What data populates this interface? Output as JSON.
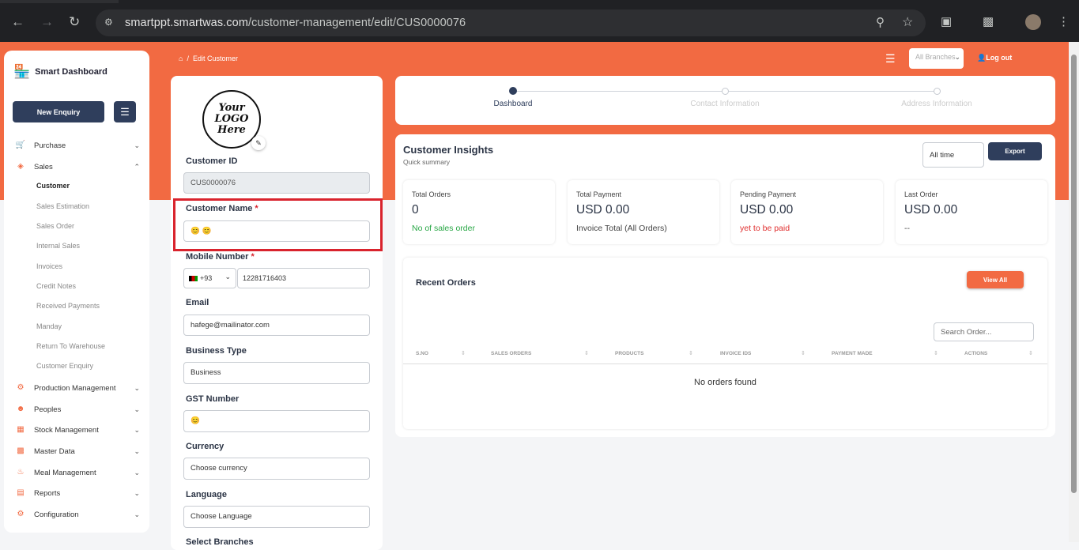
{
  "browser": {
    "url_host": "smartppt.smartwas.com",
    "url_path": "/customer-management/edit/CUS0000076"
  },
  "sidebar": {
    "brand": "Smart Dashboard",
    "new_enquiry": "New Enquiry",
    "items": [
      {
        "label": "Purchase",
        "icon": "cart-icon"
      },
      {
        "label": "Sales",
        "icon": "tag-icon"
      },
      {
        "label": "Production Management",
        "icon": "factory-icon"
      },
      {
        "label": "Peoples",
        "icon": "people-icon"
      },
      {
        "label": "Stock Management",
        "icon": "stock-icon"
      },
      {
        "label": "Master Data",
        "icon": "database-icon"
      },
      {
        "label": "Meal Management",
        "icon": "meal-icon"
      },
      {
        "label": "Reports",
        "icon": "report-icon"
      },
      {
        "label": "Configuration",
        "icon": "config-icon"
      }
    ],
    "sales_sub": [
      "Customer",
      "Sales Estimation",
      "Sales Order",
      "Internal Sales",
      "Invoices",
      "Credit Notes",
      "Received Payments",
      "Manday",
      "Return To Warehouse",
      "Customer Enquiry"
    ]
  },
  "header": {
    "breadcrumb": "Edit Customer",
    "branch_placeholder": "All Branches",
    "logout": "Log out"
  },
  "form": {
    "logo_text": "Your LOGO Here",
    "customer_id_label": "Customer ID",
    "customer_id_value": "CUS0000076",
    "customer_name_label": "Customer Name",
    "customer_name_value": "😊 😊",
    "mobile_label": "Mobile Number",
    "country_code": "+93",
    "mobile_value": "12281716403",
    "email_label": "Email",
    "email_value": "hafege@mailinator.com",
    "business_type_label": "Business Type",
    "business_type_value": "Business",
    "gst_label": "GST Number",
    "gst_value": "😊",
    "currency_label": "Currency",
    "currency_value": "Choose currency",
    "language_label": "Language",
    "language_value": "Choose Language",
    "branches_label": "Select Branches",
    "required_mark": "*"
  },
  "steps": [
    "Dashboard",
    "Contact Information",
    "Address Information"
  ],
  "insights": {
    "title": "Customer Insights",
    "subtitle": "Quick summary",
    "period": "All time",
    "export": "Export",
    "stats": [
      {
        "title": "Total Orders",
        "value": "0",
        "sub": "No of sales order",
        "sub_color": "#28a745"
      },
      {
        "title": "Total Payment",
        "value": "USD 0.00",
        "sub": "Invoice Total (All Orders)",
        "sub_color": "#444444"
      },
      {
        "title": "Pending Payment",
        "value": "USD 0.00",
        "sub": "yet to be paid",
        "sub_color": "#e03030"
      },
      {
        "title": "Last Order",
        "value": "USD 0.00",
        "sub": "--",
        "sub_color": "#444444"
      }
    ]
  },
  "orders": {
    "title": "Recent Orders",
    "view_all": "View All",
    "search_placeholder": "Search Order...",
    "columns": [
      "S.NO",
      "SALES ORDERS",
      "PRODUCTS",
      "INVOICE IDS",
      "PAYMENT MADE",
      "ACTIONS"
    ],
    "empty": "No orders found"
  },
  "colors": {
    "accent": "#f26a42",
    "primary": "#2f3e5c",
    "highlight": "#d9232d"
  }
}
